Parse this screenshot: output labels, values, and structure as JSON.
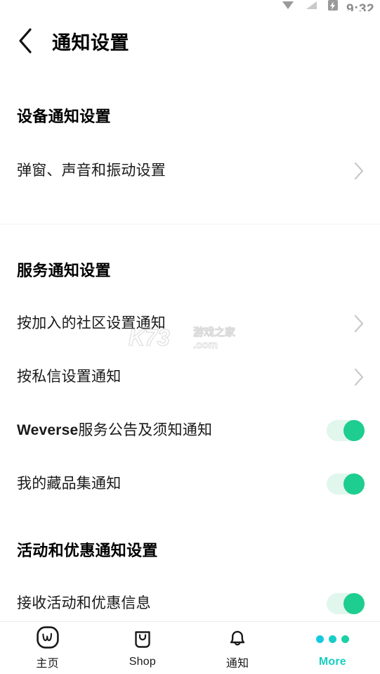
{
  "statusbar": {
    "time": "9:32",
    "icons": [
      "dropdown-triangle-icon",
      "signal-off-icon",
      "battery-icon"
    ]
  },
  "header": {
    "back_icon": "chevron-left-icon",
    "title": "通知设置"
  },
  "sections": [
    {
      "id": "device",
      "title": "设备通知设置",
      "rows": [
        {
          "id": "popup-sound-vibration",
          "label": "弹窗、声音和振动设置",
          "control": "chevron",
          "icon": "chevron-right-icon"
        }
      ]
    },
    {
      "id": "service",
      "title": "服务通知设置",
      "rows": [
        {
          "id": "community-notifications",
          "label": "按加入的社区设置通知",
          "control": "chevron",
          "icon": "chevron-right-icon"
        },
        {
          "id": "dm-notifications",
          "label": "按私信设置通知",
          "control": "chevron",
          "icon": "chevron-right-icon"
        },
        {
          "id": "weverse-notice",
          "label_bold": "Weverse",
          "label": "服务公告及须知通知",
          "control": "toggle",
          "value": "on"
        },
        {
          "id": "my-collection",
          "label": "我的藏品集通知",
          "control": "toggle",
          "value": "on"
        }
      ]
    },
    {
      "id": "events",
      "title": "活动和优惠通知设置",
      "rows": [
        {
          "id": "receive-events",
          "label": "接收活动和优惠信息",
          "control": "toggle",
          "value": "on"
        }
      ]
    }
  ],
  "bottom_nav": {
    "items": [
      {
        "id": "home",
        "label": "主页",
        "icon": "weverse-w-logo-icon",
        "active": false
      },
      {
        "id": "shop",
        "label": "Shop",
        "icon": "shopping-bag-icon",
        "active": false
      },
      {
        "id": "notif",
        "label": "通知",
        "icon": "bell-icon",
        "active": false
      },
      {
        "id": "more",
        "label": "More",
        "icon": "three-dots-icon",
        "active": true
      }
    ]
  },
  "watermark": {
    "mark": "K73",
    "text": "游戏之家",
    "domain": ".com"
  },
  "colors": {
    "toggle_on_thumb": "#1ecd90",
    "toggle_on_track": "#e1f7ee",
    "accent": "#17cfc0",
    "text": "#1a1a1a",
    "chevron": "#c8c8c8",
    "divider": "#f1f2f4"
  }
}
